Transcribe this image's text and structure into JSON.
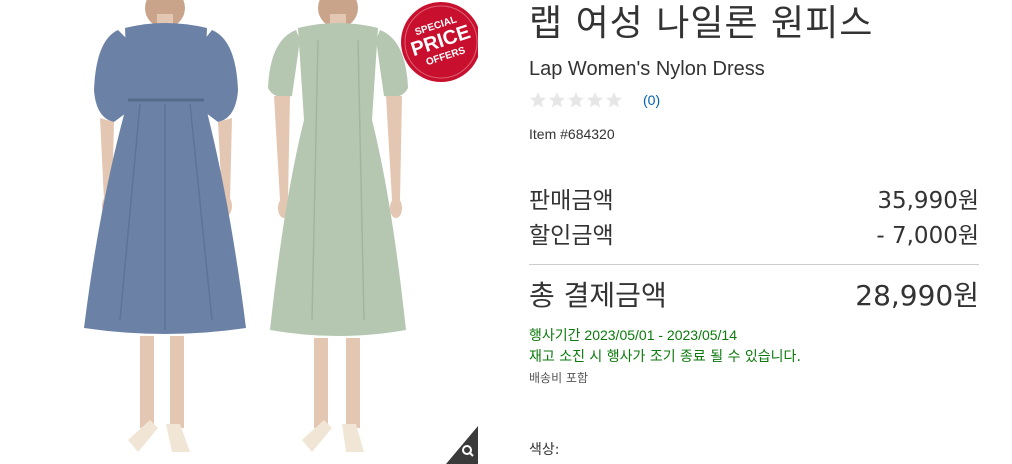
{
  "product": {
    "title_ko": "랩 여성 나일론 원피스",
    "title_en": "Lap Women's Nylon Dress",
    "rating": {
      "stars_filled": 0,
      "stars_total": 5,
      "review_count": "(0)"
    },
    "item_number": "Item #684320"
  },
  "gallery": {
    "badge": {
      "line1": "SPECIAL",
      "line2": "PRICE",
      "line3": "OFFERS"
    },
    "colors": {
      "dress_blue": "#6b82a6",
      "dress_green": "#b5c7b1",
      "badge_red": "#c8102e"
    }
  },
  "pricing": {
    "sale_label": "판매금액",
    "sale_value": "35,990원",
    "discount_label": "할인금액",
    "discount_value": "- 7,000원",
    "total_label": "총 결제금액",
    "total_value": "28,990원"
  },
  "promo": {
    "period": "행사기간 2023/05/01 - 2023/05/14",
    "notice": "재고 소진 시 행사가 조기 종료 될 수 있습니다.",
    "shipping": "배송비 포함"
  },
  "options": {
    "color_label": "색상:"
  }
}
